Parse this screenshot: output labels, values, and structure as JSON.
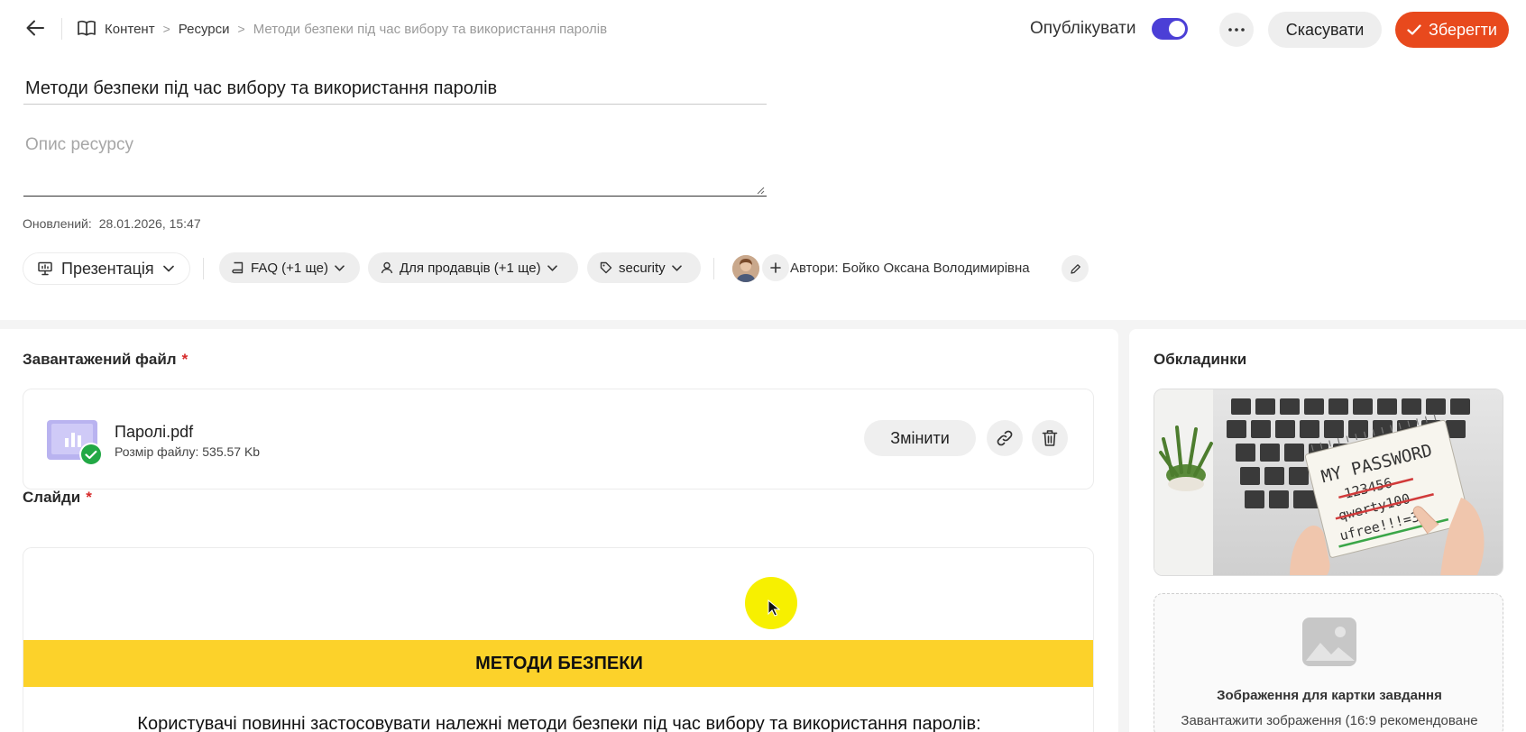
{
  "breadcrumb": {
    "items": [
      "Контент",
      "Ресурси"
    ],
    "current": "Методи безпеки під час вибору та використання паролів",
    "separator": ">"
  },
  "header": {
    "publish_label": "Опублікувати",
    "publish_on": true,
    "cancel_label": "Скасувати",
    "save_label": "Зберегти"
  },
  "resource": {
    "title": "Методи безпеки під час вибору та використання паролів",
    "description_placeholder": "Опис ресурсу",
    "updated_label": "Оновлений:",
    "updated_value": "28.01.2026, 15:47"
  },
  "chips": {
    "type": "Презентація",
    "category": "FAQ (+1 ще)",
    "audience": "Для продавців (+1 ще)",
    "tag": "security"
  },
  "authors": {
    "label": "Автори: Бойко Оксана Володимирівна"
  },
  "uploaded_file": {
    "section_label": "Завантажений файл",
    "required_mark": "*",
    "name": "Паролі.pdf",
    "size": "Розмір файлу: 535.57 Kb",
    "change_label": "Змінити"
  },
  "slides": {
    "section_label": "Слайди",
    "required_mark": "*",
    "banner": "МЕТОДИ БЕЗПЕКИ",
    "text": "Користувачі повинні застосовувати належні методи безпеки під час вибору та використання паролів:"
  },
  "covers": {
    "section_label": "Обкладинки",
    "cover_image_text": "MY PASSWORD",
    "cover_image_lines": [
      "123456",
      "qwerty100",
      "ufree!!!=3"
    ],
    "upload_title": "Зображення для картки завдання",
    "upload_subtitle": "Завантажити зображення (16:9 рекомендоване"
  },
  "colors": {
    "accent": "#e8491d",
    "toggle": "#4b3fd6",
    "banner": "#fcd22a",
    "success": "#22a845"
  },
  "icons": {
    "back": "arrow-left-icon",
    "book": "book-icon",
    "more": "ellipsis-icon",
    "check": "check-icon",
    "presentation": "presentation-icon",
    "user": "user-icon",
    "tag": "tag-icon",
    "plus": "plus-icon",
    "pencil": "pencil-icon",
    "link": "link-icon",
    "trash": "trash-icon",
    "image": "image-icon"
  }
}
